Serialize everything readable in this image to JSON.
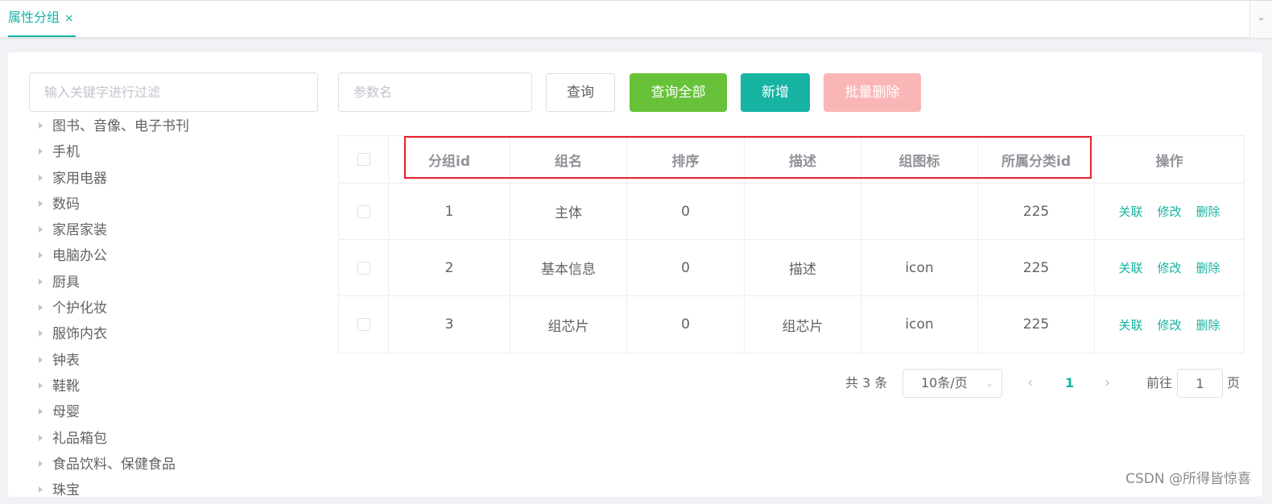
{
  "tabs": {
    "active_label": "属性分组",
    "close_glyph": "×",
    "more_glyph": "⌄"
  },
  "tree": {
    "filter_placeholder": "输入关键字进行过滤",
    "nodes": [
      "图书、音像、电子书刊",
      "手机",
      "家用电器",
      "数码",
      "家居家装",
      "电脑办公",
      "厨具",
      "个护化妆",
      "服饰内衣",
      "钟表",
      "鞋靴",
      "母婴",
      "礼品箱包",
      "食品饮料、保健食品",
      "珠宝"
    ]
  },
  "toolbar": {
    "param_placeholder": "参数名",
    "query_label": "查询",
    "query_all_label": "查询全部",
    "add_label": "新增",
    "batch_delete_label": "批量删除"
  },
  "table": {
    "headers": [
      "分组id",
      "组名",
      "排序",
      "描述",
      "组图标",
      "所属分类id",
      "操作"
    ],
    "rows": [
      {
        "id": "1",
        "name": "主体",
        "sort": "0",
        "desc": "",
        "icon": "",
        "catelog_id": "225"
      },
      {
        "id": "2",
        "name": "基本信息",
        "sort": "0",
        "desc": "描述",
        "icon": "icon",
        "catelog_id": "225"
      },
      {
        "id": "3",
        "name": "组芯片",
        "sort": "0",
        "desc": "组芯片",
        "icon": "icon",
        "catelog_id": "225"
      }
    ],
    "actions": {
      "relate": "关联",
      "edit": "修改",
      "delete": "删除"
    }
  },
  "pagination": {
    "total_text": "共 3 条",
    "page_size": "10条/页",
    "current_page": "1",
    "goto_prefix": "前往",
    "goto_value": "1",
    "goto_suffix": "页",
    "prev_glyph": "‹",
    "next_glyph": "›"
  },
  "watermark": "CSDN @所得皆惊喜",
  "colors": {
    "primary": "#17b3a3",
    "success": "#67c23a",
    "danger_disabled": "#fab6b6",
    "highlight": "#e5212c"
  }
}
